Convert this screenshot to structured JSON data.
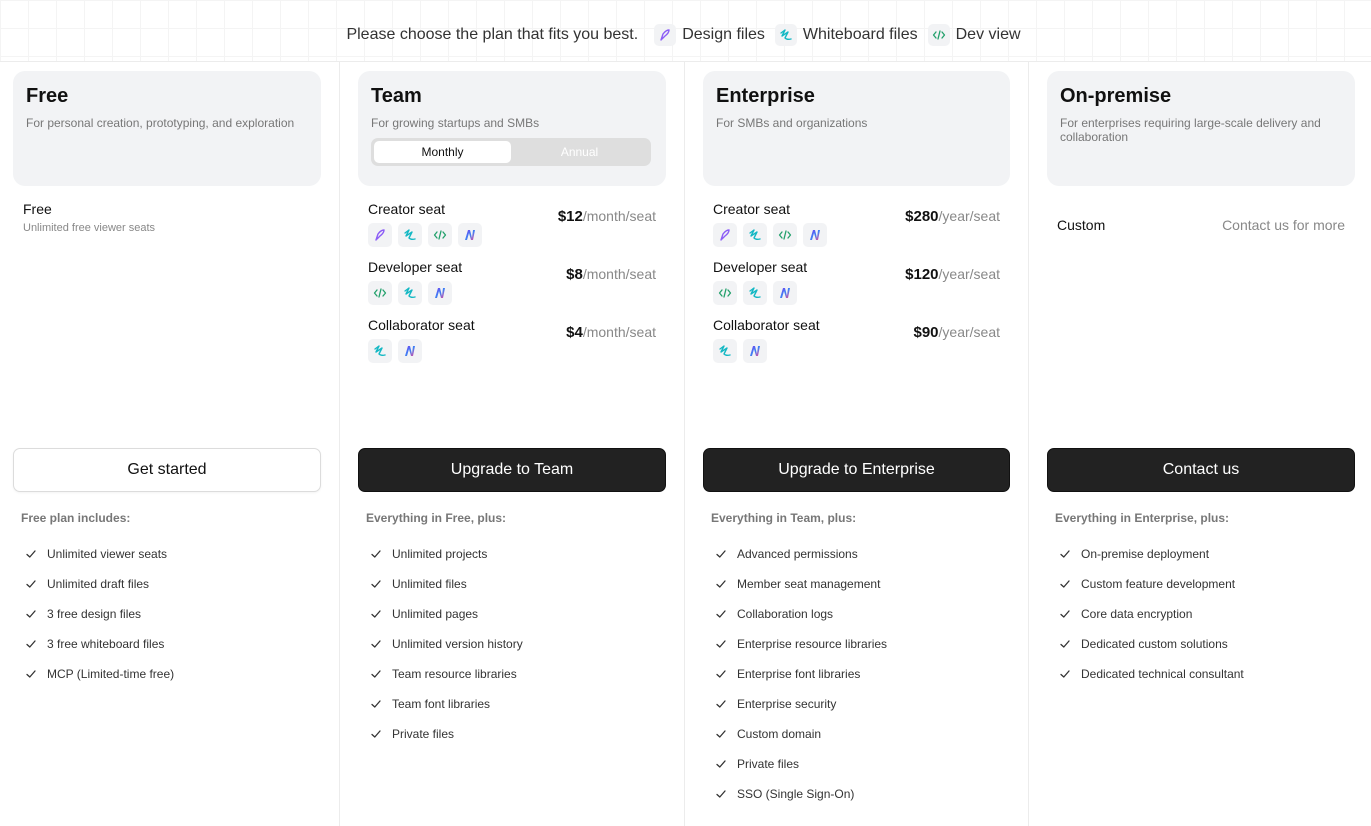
{
  "header": {
    "prompt": "Please choose the plan that fits you best.",
    "legend": [
      {
        "label": "Design files",
        "icon": "design-file-icon"
      },
      {
        "label": "Whiteboard files",
        "icon": "whiteboard-file-icon"
      },
      {
        "label": "Dev view",
        "icon": "dev-view-icon"
      }
    ]
  },
  "plans": {
    "free": {
      "name": "Free",
      "desc": "For personal creation, prototyping, and exploration",
      "price_label": "Free",
      "price_sub": "Unlimited free viewer seats",
      "cta": "Get started",
      "features_head": "Free plan includes:",
      "features": [
        "Unlimited viewer seats",
        "Unlimited draft files",
        "3 free design files",
        "3 free whiteboard files",
        "MCP (Limited-time free)"
      ]
    },
    "team": {
      "name": "Team",
      "desc": "For growing startups and SMBs",
      "toggle": {
        "monthly": "Monthly",
        "annual": "Annual",
        "selected": "Monthly"
      },
      "seats": [
        {
          "name": "Creator seat",
          "price": "$12",
          "unit": "/month/seat",
          "icons": [
            "design-file-icon",
            "whiteboard-file-icon",
            "dev-view-icon",
            "ai-icon"
          ]
        },
        {
          "name": "Developer seat",
          "price": "$8",
          "unit": "/month/seat",
          "icons": [
            "dev-view-icon",
            "whiteboard-file-icon",
            "ai-icon"
          ]
        },
        {
          "name": "Collaborator seat",
          "price": "$4",
          "unit": "/month/seat",
          "icons": [
            "whiteboard-file-icon",
            "ai-icon"
          ]
        }
      ],
      "cta": "Upgrade to Team",
      "features_head": "Everything in Free, plus:",
      "features": [
        "Unlimited projects",
        "Unlimited files",
        "Unlimited pages",
        "Unlimited version history",
        "Team resource libraries",
        "Team font libraries",
        "Private files"
      ]
    },
    "enterprise": {
      "name": "Enterprise",
      "desc": "For SMBs and organizations",
      "seats": [
        {
          "name": "Creator seat",
          "price": "$280",
          "unit": "/year/seat",
          "icons": [
            "design-file-icon",
            "whiteboard-file-icon",
            "dev-view-icon",
            "ai-icon"
          ]
        },
        {
          "name": "Developer seat",
          "price": "$120",
          "unit": "/year/seat",
          "icons": [
            "dev-view-icon",
            "whiteboard-file-icon",
            "ai-icon"
          ]
        },
        {
          "name": "Collaborator seat",
          "price": "$90",
          "unit": "/year/seat",
          "icons": [
            "whiteboard-file-icon",
            "ai-icon"
          ]
        }
      ],
      "cta": "Upgrade to Enterprise",
      "features_head": "Everything in Team, plus:",
      "features": [
        "Advanced permissions",
        "Member seat management",
        "Collaboration logs",
        "Enterprise resource libraries",
        "Enterprise font libraries",
        "Enterprise security",
        "Custom domain",
        "Private files",
        "SSO (Single Sign-On)"
      ]
    },
    "onprem": {
      "name": "On-premise",
      "desc": "For enterprises requiring large-scale delivery and collaboration",
      "price_label": "Custom",
      "contact_text": "Contact us for more",
      "cta": "Contact us",
      "features_head": "Everything in Enterprise, plus:",
      "features": [
        "On-premise deployment",
        "Custom feature development",
        "Core data encryption",
        "Dedicated custom solutions",
        "Dedicated technical consultant"
      ]
    }
  },
  "colors": {
    "design": "#8b5cf6",
    "whiteboard": "#14b8c4",
    "dev": "#22a06b",
    "dark_button": "#222222"
  }
}
